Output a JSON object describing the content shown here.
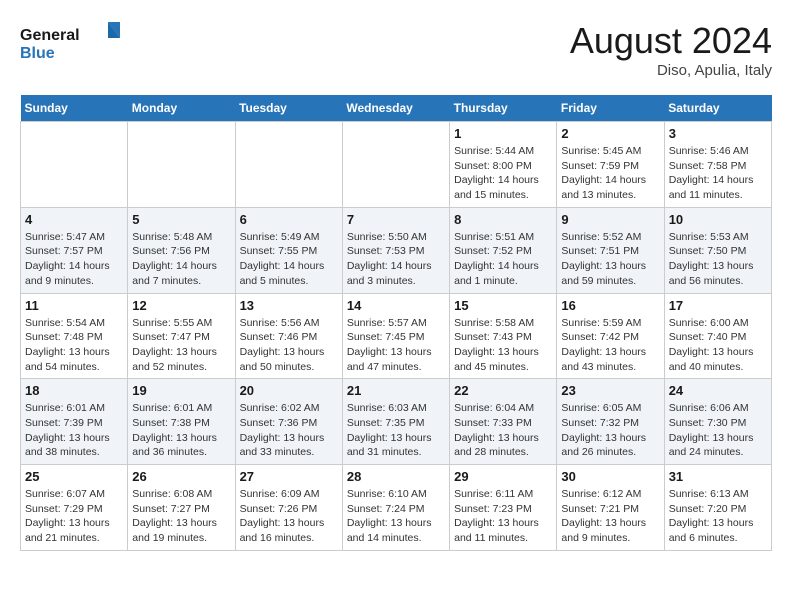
{
  "header": {
    "logo_line1": "General",
    "logo_line2": "Blue",
    "month_year": "August 2024",
    "location": "Diso, Apulia, Italy"
  },
  "weekdays": [
    "Sunday",
    "Monday",
    "Tuesday",
    "Wednesday",
    "Thursday",
    "Friday",
    "Saturday"
  ],
  "weeks": [
    [
      {
        "day": "",
        "info": ""
      },
      {
        "day": "",
        "info": ""
      },
      {
        "day": "",
        "info": ""
      },
      {
        "day": "",
        "info": ""
      },
      {
        "day": "1",
        "info": "Sunrise: 5:44 AM\nSunset: 8:00 PM\nDaylight: 14 hours\nand 15 minutes."
      },
      {
        "day": "2",
        "info": "Sunrise: 5:45 AM\nSunset: 7:59 PM\nDaylight: 14 hours\nand 13 minutes."
      },
      {
        "day": "3",
        "info": "Sunrise: 5:46 AM\nSunset: 7:58 PM\nDaylight: 14 hours\nand 11 minutes."
      }
    ],
    [
      {
        "day": "4",
        "info": "Sunrise: 5:47 AM\nSunset: 7:57 PM\nDaylight: 14 hours\nand 9 minutes."
      },
      {
        "day": "5",
        "info": "Sunrise: 5:48 AM\nSunset: 7:56 PM\nDaylight: 14 hours\nand 7 minutes."
      },
      {
        "day": "6",
        "info": "Sunrise: 5:49 AM\nSunset: 7:55 PM\nDaylight: 14 hours\nand 5 minutes."
      },
      {
        "day": "7",
        "info": "Sunrise: 5:50 AM\nSunset: 7:53 PM\nDaylight: 14 hours\nand 3 minutes."
      },
      {
        "day": "8",
        "info": "Sunrise: 5:51 AM\nSunset: 7:52 PM\nDaylight: 14 hours\nand 1 minute."
      },
      {
        "day": "9",
        "info": "Sunrise: 5:52 AM\nSunset: 7:51 PM\nDaylight: 13 hours\nand 59 minutes."
      },
      {
        "day": "10",
        "info": "Sunrise: 5:53 AM\nSunset: 7:50 PM\nDaylight: 13 hours\nand 56 minutes."
      }
    ],
    [
      {
        "day": "11",
        "info": "Sunrise: 5:54 AM\nSunset: 7:48 PM\nDaylight: 13 hours\nand 54 minutes."
      },
      {
        "day": "12",
        "info": "Sunrise: 5:55 AM\nSunset: 7:47 PM\nDaylight: 13 hours\nand 52 minutes."
      },
      {
        "day": "13",
        "info": "Sunrise: 5:56 AM\nSunset: 7:46 PM\nDaylight: 13 hours\nand 50 minutes."
      },
      {
        "day": "14",
        "info": "Sunrise: 5:57 AM\nSunset: 7:45 PM\nDaylight: 13 hours\nand 47 minutes."
      },
      {
        "day": "15",
        "info": "Sunrise: 5:58 AM\nSunset: 7:43 PM\nDaylight: 13 hours\nand 45 minutes."
      },
      {
        "day": "16",
        "info": "Sunrise: 5:59 AM\nSunset: 7:42 PM\nDaylight: 13 hours\nand 43 minutes."
      },
      {
        "day": "17",
        "info": "Sunrise: 6:00 AM\nSunset: 7:40 PM\nDaylight: 13 hours\nand 40 minutes."
      }
    ],
    [
      {
        "day": "18",
        "info": "Sunrise: 6:01 AM\nSunset: 7:39 PM\nDaylight: 13 hours\nand 38 minutes."
      },
      {
        "day": "19",
        "info": "Sunrise: 6:01 AM\nSunset: 7:38 PM\nDaylight: 13 hours\nand 36 minutes."
      },
      {
        "day": "20",
        "info": "Sunrise: 6:02 AM\nSunset: 7:36 PM\nDaylight: 13 hours\nand 33 minutes."
      },
      {
        "day": "21",
        "info": "Sunrise: 6:03 AM\nSunset: 7:35 PM\nDaylight: 13 hours\nand 31 minutes."
      },
      {
        "day": "22",
        "info": "Sunrise: 6:04 AM\nSunset: 7:33 PM\nDaylight: 13 hours\nand 28 minutes."
      },
      {
        "day": "23",
        "info": "Sunrise: 6:05 AM\nSunset: 7:32 PM\nDaylight: 13 hours\nand 26 minutes."
      },
      {
        "day": "24",
        "info": "Sunrise: 6:06 AM\nSunset: 7:30 PM\nDaylight: 13 hours\nand 24 minutes."
      }
    ],
    [
      {
        "day": "25",
        "info": "Sunrise: 6:07 AM\nSunset: 7:29 PM\nDaylight: 13 hours\nand 21 minutes."
      },
      {
        "day": "26",
        "info": "Sunrise: 6:08 AM\nSunset: 7:27 PM\nDaylight: 13 hours\nand 19 minutes."
      },
      {
        "day": "27",
        "info": "Sunrise: 6:09 AM\nSunset: 7:26 PM\nDaylight: 13 hours\nand 16 minutes."
      },
      {
        "day": "28",
        "info": "Sunrise: 6:10 AM\nSunset: 7:24 PM\nDaylight: 13 hours\nand 14 minutes."
      },
      {
        "day": "29",
        "info": "Sunrise: 6:11 AM\nSunset: 7:23 PM\nDaylight: 13 hours\nand 11 minutes."
      },
      {
        "day": "30",
        "info": "Sunrise: 6:12 AM\nSunset: 7:21 PM\nDaylight: 13 hours\nand 9 minutes."
      },
      {
        "day": "31",
        "info": "Sunrise: 6:13 AM\nSunset: 7:20 PM\nDaylight: 13 hours\nand 6 minutes."
      }
    ]
  ]
}
